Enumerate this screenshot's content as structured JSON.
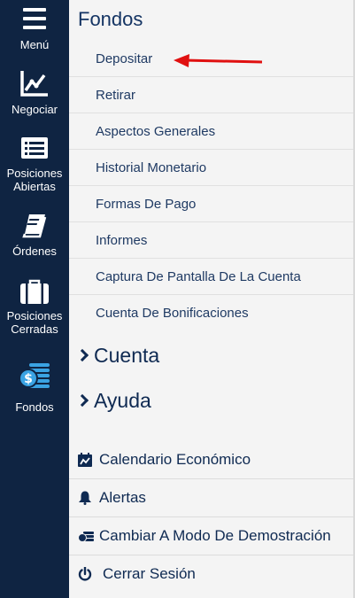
{
  "rail": {
    "items": [
      {
        "label": "Menú",
        "icon": "hamburger-icon"
      },
      {
        "label": "Negociar",
        "icon": "chart-line-icon"
      },
      {
        "label": "Posiciones\nAbiertas",
        "icon": "list-icon"
      },
      {
        "label": "Órdenes",
        "icon": "book-icon"
      },
      {
        "label": "Posiciones\nCerradas",
        "icon": "briefcase-icon"
      },
      {
        "label": "Fondos",
        "icon": "coins-icon"
      }
    ]
  },
  "panel": {
    "title": "Fondos",
    "sub_items": [
      "Depositar",
      "Retirar",
      "Aspectos Generales",
      "Historial Monetario",
      "Formas De Pago",
      "Informes",
      "Captura De Pantalla De La Cuenta",
      "Cuenta De Bonificaciones"
    ],
    "sections": [
      "Cuenta",
      "Ayuda"
    ],
    "bottom_items": [
      {
        "label": "Calendario Económico",
        "icon": "calendar-icon"
      },
      {
        "label": "Alertas",
        "icon": "bell-icon"
      },
      {
        "label": "Cambiar A Modo De Demostración",
        "icon": "money-icon"
      },
      {
        "label": "Cerrar Sesión",
        "icon": "power-icon"
      }
    ]
  },
  "colors": {
    "rail_bg": "#0f2442",
    "panel_bg": "#f4f4f4",
    "accent_text": "#143463",
    "coins_blue": "#3aa3e3",
    "annotation_red": "#e01010"
  }
}
